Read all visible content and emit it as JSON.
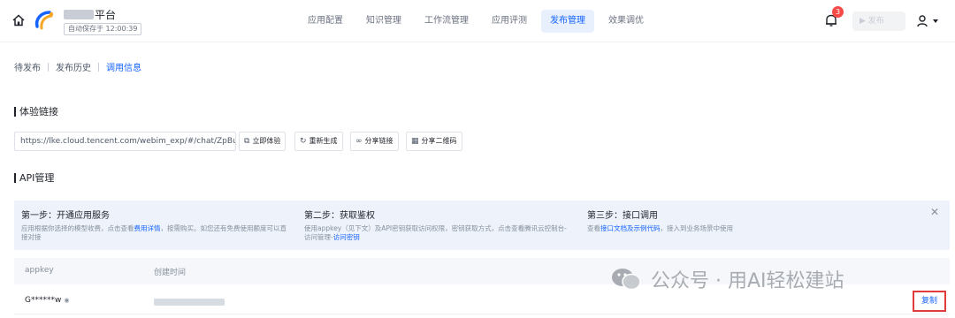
{
  "header": {
    "brand_suffix": "平台",
    "saved_text": "自动保存于 12:00:39",
    "nav": [
      "应用配置",
      "知识管理",
      "工作流管理",
      "应用评测",
      "发布管理",
      "效果调优"
    ],
    "active_nav_index": 4,
    "notification_count": "3",
    "publish_label": "▶ 发布"
  },
  "subtabs": {
    "items": [
      "待发布",
      "发布历史",
      "调用信息"
    ],
    "active_index": 2
  },
  "experience": {
    "title": "体验链接",
    "url": "https://lke.cloud.tencent.com/webim_exp/#/chat/ZpBuzf",
    "buttons": [
      {
        "icon": "open-icon",
        "label": "立即体验"
      },
      {
        "icon": "refresh-icon",
        "label": "重新生成"
      },
      {
        "icon": "link-icon",
        "label": "分享链接"
      },
      {
        "icon": "qrcode-icon",
        "label": "分享二维码"
      }
    ]
  },
  "api": {
    "title": "API管理",
    "steps": [
      {
        "title": "第一步：开通应用服务",
        "desc_pre": "应用根据你选择的模型收费，点击查看",
        "link": "费用详情",
        "desc_post": "，按需购买。如您还有免费使用额度可以直接对接"
      },
      {
        "title": "第二步：获取鉴权",
        "desc_pre": "使用appkey（见下文）及API密钥获取访问权限，密钥获取方式，点击查看腾讯云控制台-访问管理-",
        "link": "访问密钥",
        "desc_post": ""
      },
      {
        "title": "第三步：接口调用",
        "desc_pre": "查看",
        "link": "接口文档及示例代码",
        "desc_post": "，接入到业务场景中使用"
      }
    ],
    "table": {
      "columns": [
        "appkey",
        "创建时间"
      ],
      "rows": [
        {
          "appkey": "G******w",
          "action": "复制"
        }
      ]
    }
  },
  "watermark": "公众号 · 用AI轻松建站",
  "colors": {
    "accent": "#1664ff",
    "badge": "#f54a45",
    "highlight_box": "#e23b3b",
    "banner": "#edf2fb"
  }
}
